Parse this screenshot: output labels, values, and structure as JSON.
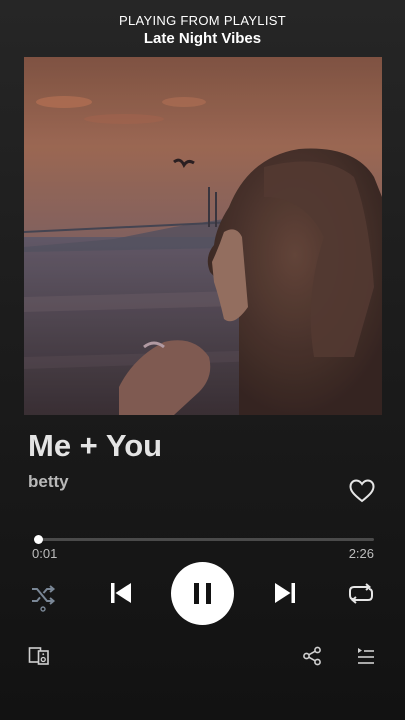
{
  "header": {
    "context_label": "PLAYING FROM PLAYLIST",
    "playlist_name": "Late Night Vibes"
  },
  "track": {
    "title": "Me + You",
    "artist": "betty",
    "liked": false
  },
  "playback": {
    "elapsed": "0:01",
    "total": "2:26",
    "progress_fraction": 0.007,
    "state": "playing",
    "shuffle": false,
    "repeat": "off"
  },
  "icons": {
    "like": "heart-outline-icon",
    "shuffle": "shuffle-icon",
    "previous": "skip-previous-icon",
    "play_pause": "pause-icon",
    "next": "skip-next-icon",
    "repeat": "repeat-icon",
    "devices": "connect-devices-icon",
    "share": "share-icon",
    "queue": "queue-icon"
  },
  "colors": {
    "background_top": "#262626",
    "background_bottom": "#121212",
    "accent": "#ffffff",
    "muted_text": "#b9b9b9",
    "inactive_icon": "#7a8796"
  }
}
